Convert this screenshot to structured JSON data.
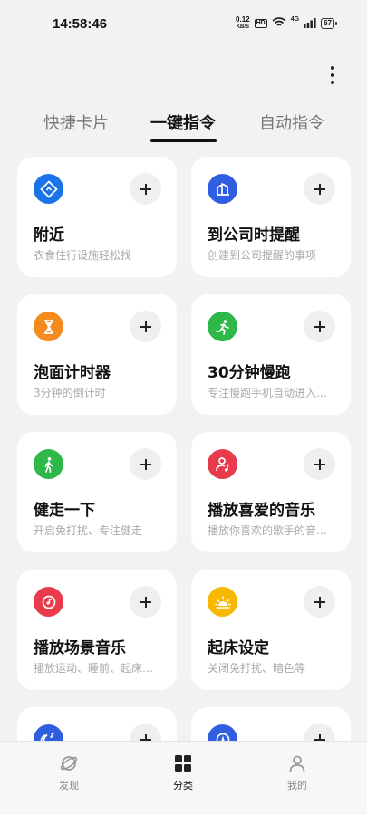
{
  "status_bar": {
    "time": "14:58:46",
    "net_speed_value": "0.12",
    "net_speed_unit": "KB/S",
    "hd": "HD",
    "network": "4G",
    "battery": "67"
  },
  "tabs": [
    {
      "label": "快捷卡片",
      "active": false
    },
    {
      "label": "一键指令",
      "active": true
    },
    {
      "label": "自动指令",
      "active": false
    }
  ],
  "cards": [
    {
      "title": "附近",
      "desc": "衣食住行设施轻松找",
      "icon": "location-diamond-icon",
      "color": "#1a73e8"
    },
    {
      "title": "到公司时提醒",
      "desc": "创建到公司提醒的事项",
      "icon": "office-building-icon",
      "color": "#2f5fe0"
    },
    {
      "title": "泡面计时器",
      "desc": "3分钟的倒计时",
      "icon": "hourglass-icon",
      "color": "#f58a1f"
    },
    {
      "title": "30分钟慢跑",
      "desc": "专注慢跑手机自动进入…",
      "icon": "running-icon",
      "color": "#2fb84a"
    },
    {
      "title": "健走一下",
      "desc": "开启免打扰、专注健走",
      "icon": "walking-icon",
      "color": "#2fb84a"
    },
    {
      "title": "播放喜爱的音乐",
      "desc": "播放你喜欢的歌手的音…",
      "icon": "user-music-icon",
      "color": "#e83b4b"
    },
    {
      "title": "播放场景音乐",
      "desc": "播放运动、睡前、起床…",
      "icon": "music-disc-icon",
      "color": "#e83b4b"
    },
    {
      "title": "起床设定",
      "desc": "关闭免打扰、暗色等",
      "icon": "sunrise-icon",
      "color": "#f6b800"
    },
    {
      "title": "",
      "desc": "",
      "icon": "moon-sleep-icon",
      "color": "#2f5fe0"
    },
    {
      "title": "",
      "desc": "",
      "icon": "compass-icon",
      "color": "#2f5fe0"
    }
  ],
  "bottom_nav": [
    {
      "label": "发现",
      "icon": "planet-icon",
      "active": false
    },
    {
      "label": "分类",
      "icon": "grid-icon",
      "active": true
    },
    {
      "label": "我的",
      "icon": "person-icon",
      "active": false
    }
  ],
  "colors": {
    "background": "#f2f2f2",
    "card": "#ffffff",
    "muted_text": "#aaaaaa"
  }
}
